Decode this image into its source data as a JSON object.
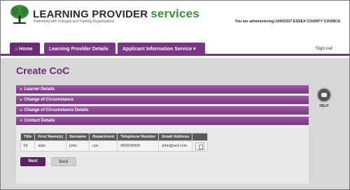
{
  "header": {
    "brand_name": "LEARNING PROVIDER",
    "brand_services": "services",
    "tagline": "Partnering with Colleges and Training Organisations",
    "admin_text": "You are administering:10002327 ESSEX COUNTY COUNCIL"
  },
  "nav": {
    "home": "⌂ Home",
    "learning_provider_details": "Learning Provider Details",
    "applicant_information_service": "Applicant Information Service ▾",
    "sign_out": "Sign out"
  },
  "page": {
    "title": "Create CoC"
  },
  "accordion": [
    {
      "label": "Learner Details",
      "arrow": "▸"
    },
    {
      "label": "Change of Circumstance",
      "arrow": "▸"
    },
    {
      "label": "Change of Circumstance Details",
      "arrow": "▸"
    },
    {
      "label": "Contact Details",
      "arrow": "▾"
    }
  ],
  "contacts": {
    "headers": [
      "Title",
      "First Name(s)",
      "Surname",
      "Department",
      "Telephone Number",
      "Email Address",
      ""
    ],
    "rows": [
      [
        "Dr",
        "alan",
        "john",
        "cpc",
        "000000000",
        "john@aol.com"
      ]
    ]
  },
  "buttons": {
    "next": "Next",
    "back": "Back"
  },
  "help": {
    "label": "HELP"
  },
  "colors": {
    "brand_purple": "#7b3585",
    "brand_green": "#3a8f3a"
  }
}
